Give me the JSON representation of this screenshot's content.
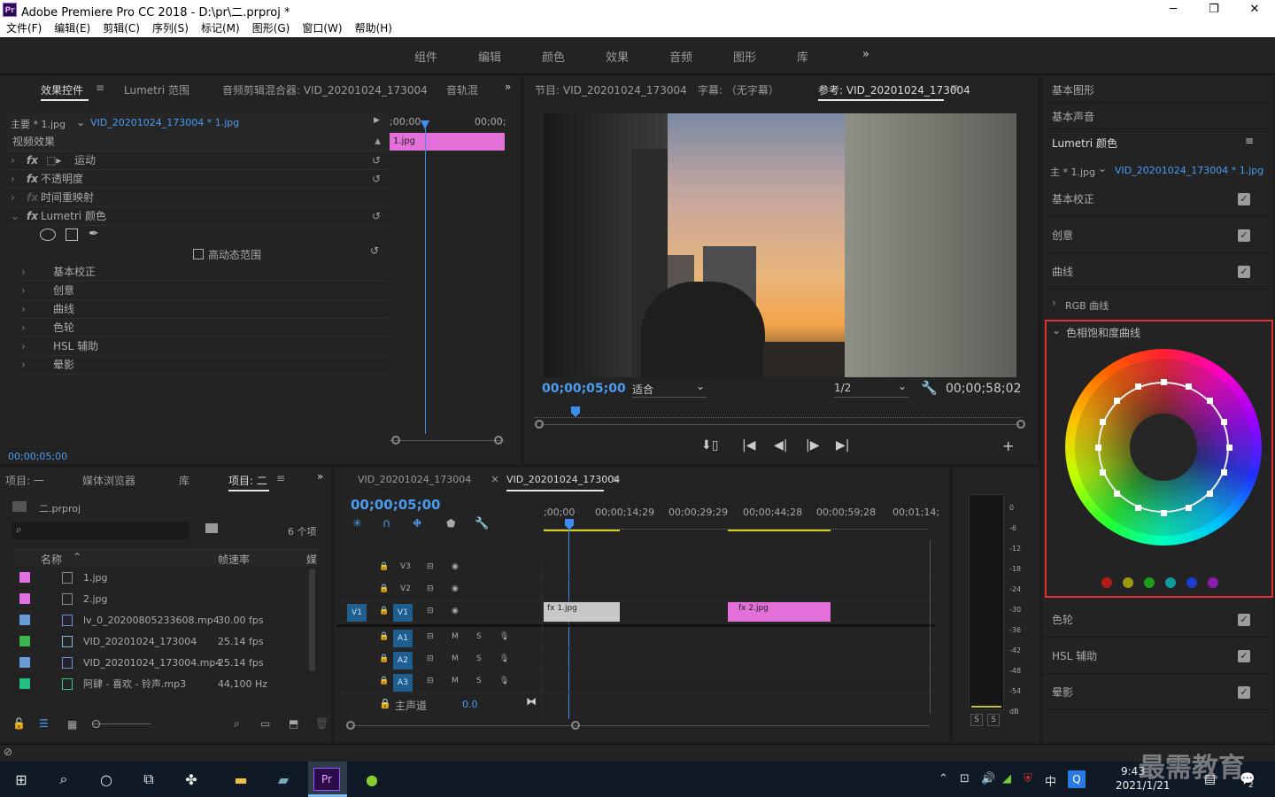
{
  "window": {
    "title": "Adobe Premiere Pro CC 2018 - D:\\pr\\二.prproj *",
    "app_icon": "Pr",
    "minimize": "─",
    "maximize": "❐",
    "close": "✕"
  },
  "menu": [
    "文件(F)",
    "编辑(E)",
    "剪辑(C)",
    "序列(S)",
    "标记(M)",
    "图形(G)",
    "窗口(W)",
    "帮助(H)"
  ],
  "workspaces": [
    "组件",
    "编辑",
    "颜色",
    "效果",
    "音频",
    "图形",
    "库",
    "»"
  ],
  "effect_controls": {
    "tabs": [
      "效果控件",
      "Lumetri 范围",
      "音频剪辑混合器: VID_20201024_173004",
      "音轨混"
    ],
    "source": "主要 * 1.jpg",
    "clip": "VID_20201024_173004 * 1.jpg",
    "tc_start": ";00;00",
    "tc_end": "00;00;",
    "clip_label": "1.jpg",
    "section": "视频效果",
    "effects": [
      "运动",
      "不透明度",
      "时间重映射",
      "Lumetri 颜色"
    ],
    "hdr": "高动态范围",
    "subs": [
      "基本校正",
      "创意",
      "曲线",
      "色轮",
      "HSL 辅助",
      "晕影"
    ],
    "timecode": "00;00;05;00"
  },
  "program": {
    "tabs": [
      "节目: VID_20201024_173004",
      "字幕: （无字幕）",
      "参考: VID_20201024_173004"
    ],
    "timecode": "00;00;05;00",
    "fit": "适合",
    "res": "1/2",
    "duration": "00;00;58;02"
  },
  "lumetri": {
    "top_items": [
      "基本图形",
      "基本声音"
    ],
    "title": "Lumetri 颜色",
    "source": "主 * 1.jpg",
    "clip": "VID_20201024_173004 * 1.jpg",
    "sections": [
      "基本校正",
      "创意",
      "曲线"
    ],
    "rgb_curves": "RGB 曲线",
    "hue_sat": "色相饱和度曲线",
    "sections2": [
      "色轮",
      "HSL 辅助",
      "晕影"
    ],
    "highlight_color": "#e03030",
    "swatches": [
      "#b01c1c",
      "#9c9a10",
      "#1c9c1c",
      "#109c9c",
      "#1c3cd0",
      "#8c1cac"
    ]
  },
  "project": {
    "tabs": [
      "项目: 一",
      "媒体浏览器",
      "库",
      "项目: 二"
    ],
    "name": "二.prproj",
    "count": "6 个项",
    "cols": [
      "名称",
      "帧速率",
      "媒"
    ],
    "items": [
      {
        "color": "#e070e0",
        "name": "1.jpg",
        "fps": ""
      },
      {
        "color": "#e070e0",
        "name": "2.jpg",
        "fps": ""
      },
      {
        "color": "#6c9cd8",
        "name": "lv_0_20200805233608.mp4",
        "fps": "30.00 fps"
      },
      {
        "color": "#3cb44c",
        "name": "VID_20201024_173004",
        "fps": "25.14 fps"
      },
      {
        "color": "#6c9cd8",
        "name": "VID_20201024_173004.mp4",
        "fps": "25.14 fps"
      },
      {
        "color": "#20c080",
        "name": "阿肆 - 喜欢 - 铃声.mp3",
        "fps": "44,100 Hz"
      }
    ]
  },
  "timeline": {
    "tabs": [
      "VID_20201024_173004",
      "VID_20201024_173004"
    ],
    "timecode": "00;00;05;00",
    "ruler": [
      ";00;00",
      "00;00;14;29",
      "00;00;29;29",
      "00;00;44;28",
      "00;00;59;28",
      "00;01;14;"
    ],
    "video_tracks": [
      "V3",
      "V2",
      "V1"
    ],
    "audio_tracks": [
      "A1",
      "A2",
      "A3"
    ],
    "master": "主声道",
    "master_val": "0.0",
    "clips": [
      "1.jpg",
      "2.jpg"
    ],
    "m": "M",
    "s": "S",
    "src": "V1"
  },
  "meter": {
    "scale": [
      "0",
      "-6",
      "-12",
      "-18",
      "-24",
      "-30",
      "-36",
      "-42",
      "-48",
      "-54",
      "dB"
    ],
    "solo": [
      "S",
      "S"
    ]
  },
  "taskbar": {
    "time": "9:43",
    "date": "2021/1/21",
    "ime": "中",
    "watermark": "最需教育",
    "notif": "2"
  }
}
